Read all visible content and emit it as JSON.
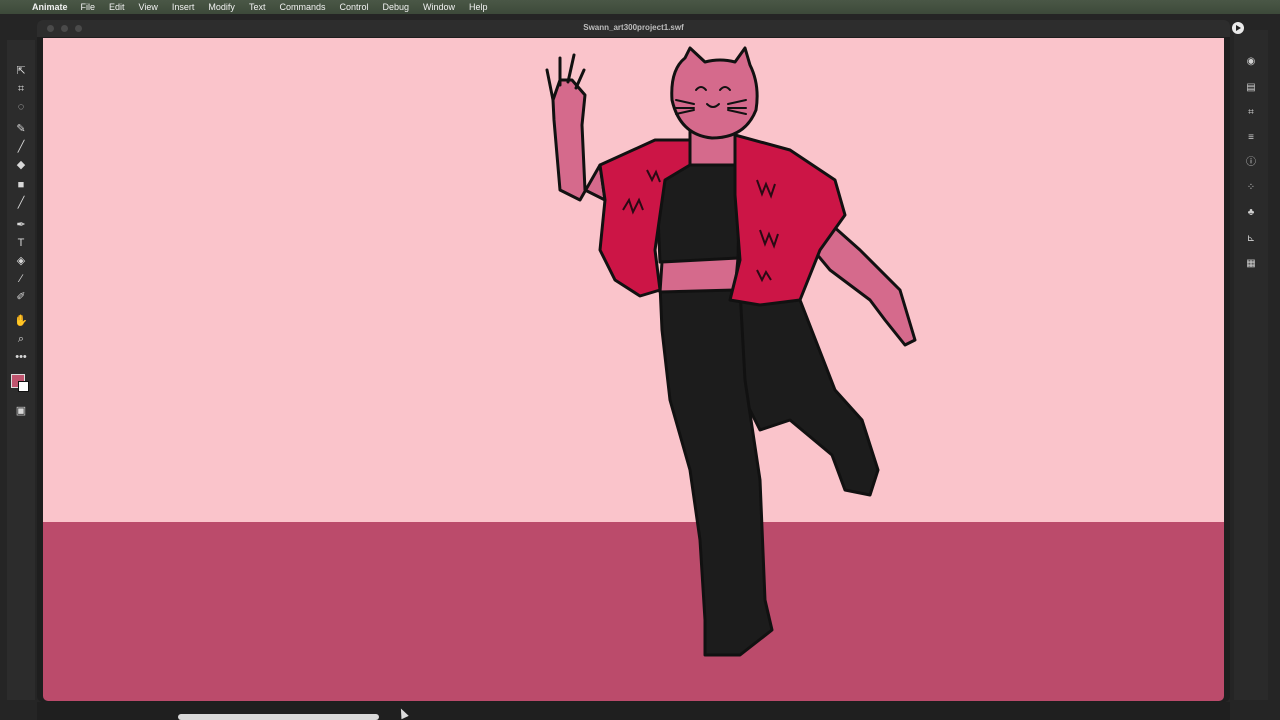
{
  "menubar": {
    "app_name": "Animate",
    "items": [
      "File",
      "Edit",
      "View",
      "Insert",
      "Modify",
      "Text",
      "Commands",
      "Control",
      "Debug",
      "Window",
      "Help"
    ]
  },
  "player": {
    "title": "Swann_art300project1.swf"
  },
  "tools": [
    "selection-tool",
    "free-transform-tool",
    "lasso-tool",
    "paint-brush-tool",
    "brush-tool",
    "eraser-tool",
    "rectangle-tool",
    "line-tool",
    "pen-tool",
    "text-tool",
    "paint-bucket-tool",
    "eyedropper-tool",
    "pin-tool",
    "hand-tool",
    "zoom-tool",
    "more-tools",
    "swap-colors",
    "stroke-color",
    "fill-color",
    "object-drawing-mode"
  ],
  "dock_icons": [
    "properties-icon",
    "library-icon",
    "transform-icon",
    "align-icon",
    "info-icon",
    "assets-icon",
    "components-icon",
    "motion-presets-icon",
    "layer-depth-icon"
  ],
  "colors": {
    "sky": "#fac4cb",
    "floor": "#bb4b6b",
    "vest": "#cc1546",
    "skin": "#d56a8c",
    "clothes": "#1c1c1c",
    "fill_swatch": "#c0556f"
  }
}
